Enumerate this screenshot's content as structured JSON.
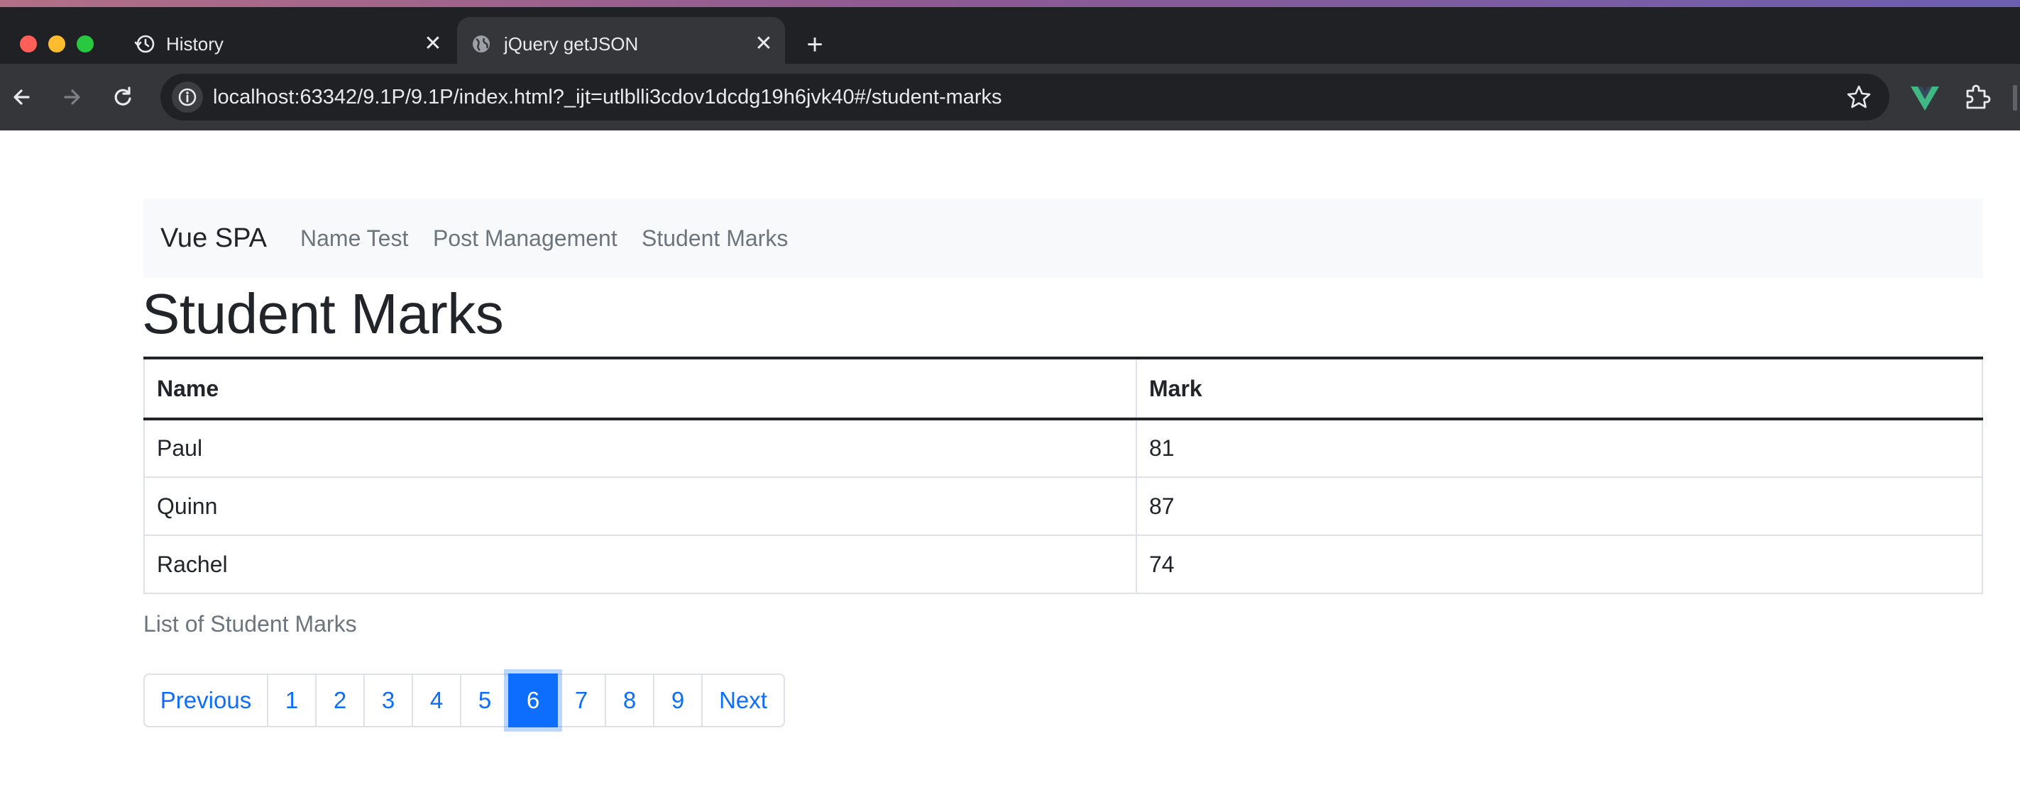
{
  "browser": {
    "tabs": [
      {
        "title": "History",
        "icon": "history-icon",
        "active": false
      },
      {
        "title": "jQuery getJSON",
        "icon": "globe-icon",
        "active": true
      }
    ],
    "close_glyph": "✕",
    "new_tab_glyph": "+",
    "url": "localhost:63342/9.1P/9.1P/index.html?_ijt=utlblli3cdov1dcdg19h6jvk40#/student-marks",
    "colors": {
      "tabbar": "#202124",
      "toolbar": "#35363a",
      "vue_extension": "#41b883"
    }
  },
  "navbar": {
    "brand": "Vue SPA",
    "links": [
      "Name Test",
      "Post Management",
      "Student Marks"
    ]
  },
  "page": {
    "title": "Student Marks",
    "table": {
      "headers": [
        "Name",
        "Mark"
      ],
      "rows": [
        {
          "name": "Paul",
          "mark": "81"
        },
        {
          "name": "Quinn",
          "mark": "87"
        },
        {
          "name": "Rachel",
          "mark": "74"
        }
      ]
    },
    "caption": "List of Student Marks",
    "pagination": {
      "previous": "Previous",
      "pages": [
        "1",
        "2",
        "3",
        "4",
        "5",
        "6",
        "7",
        "8",
        "9"
      ],
      "current": "6",
      "next": "Next",
      "accent": "#0d6efd"
    }
  }
}
